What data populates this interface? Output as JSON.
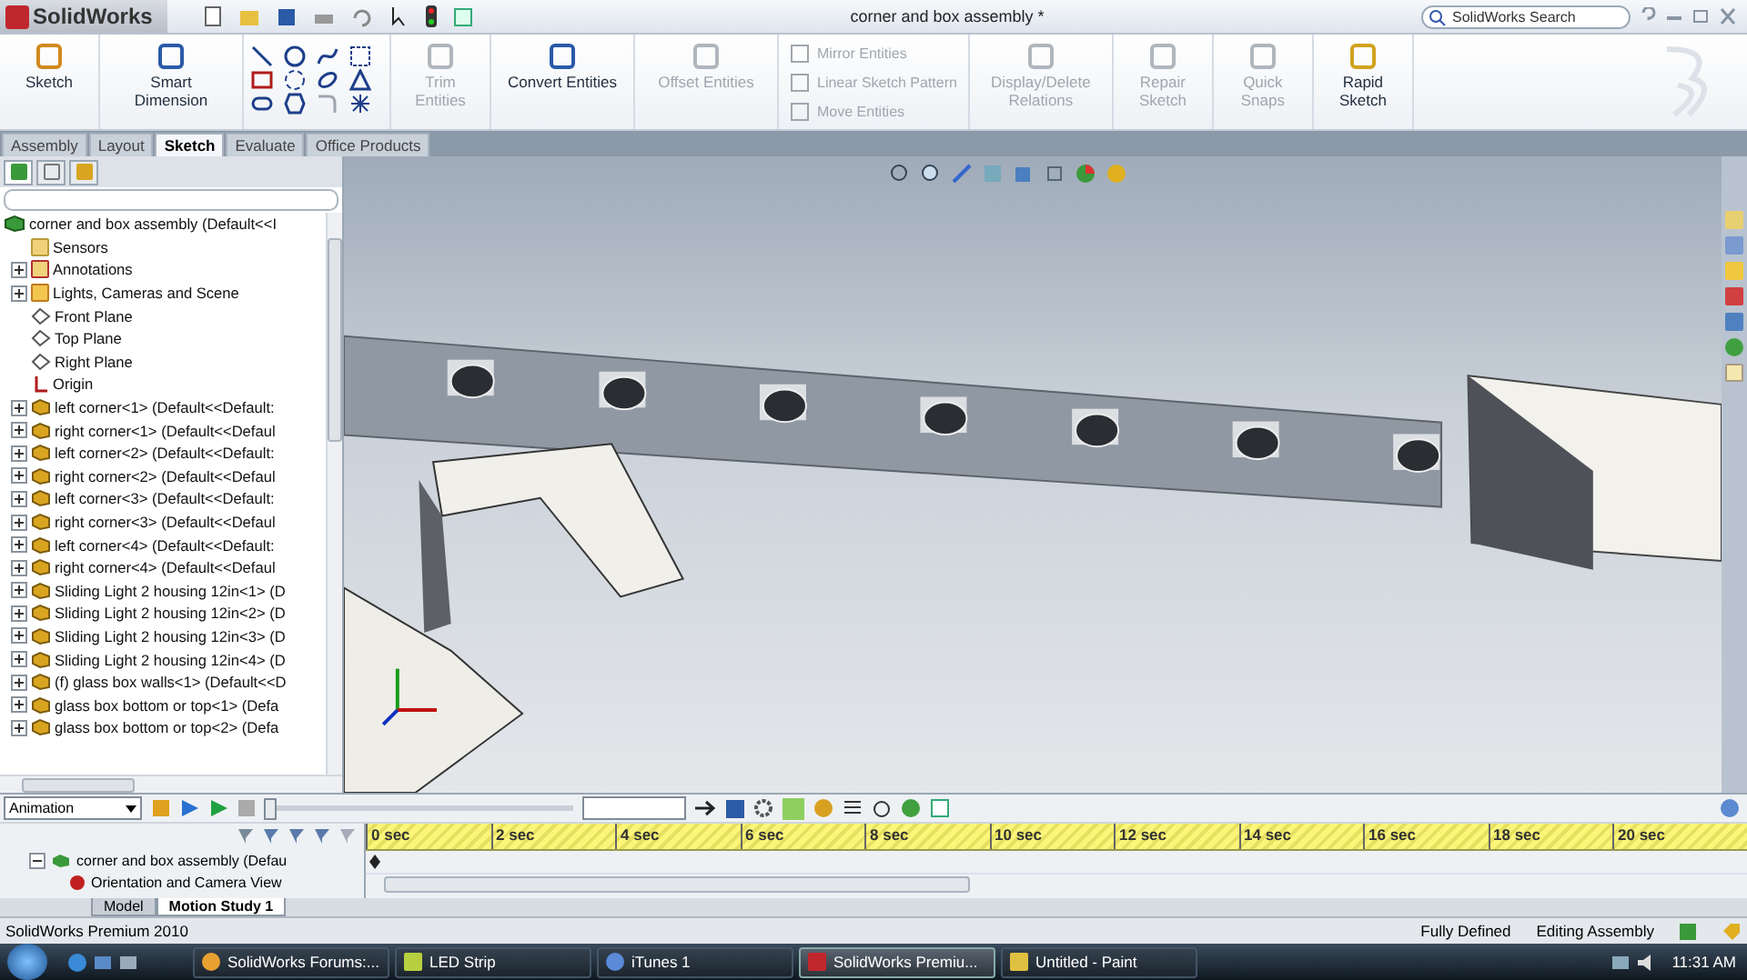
{
  "window": {
    "app_name": "SolidWorks",
    "title": "corner and box assembly *",
    "search": {
      "placeholder": "SolidWorks Search"
    }
  },
  "ribbon": {
    "commands": [
      {
        "label": "Sketch",
        "disabled": false,
        "kind": "large"
      },
      {
        "label": "Smart Dimension",
        "disabled": false,
        "kind": "large"
      },
      {
        "kind": "tools"
      },
      {
        "label": "Trim Entities",
        "disabled": true,
        "kind": "large"
      },
      {
        "label": "Convert Entities",
        "disabled": false,
        "kind": "large"
      },
      {
        "label": "Offset Entities",
        "disabled": true,
        "kind": "large"
      },
      {
        "kind": "list",
        "items": [
          {
            "label": "Mirror Entities",
            "disabled": true
          },
          {
            "label": "Linear Sketch Pattern",
            "disabled": true
          },
          {
            "label": "Move Entities",
            "disabled": true
          }
        ]
      },
      {
        "label": "Display/Delete Relations",
        "disabled": true,
        "kind": "large"
      },
      {
        "label": "Repair Sketch",
        "disabled": true,
        "kind": "large"
      },
      {
        "label": "Quick Snaps",
        "disabled": true,
        "kind": "large"
      },
      {
        "label": "Rapid Sketch",
        "disabled": false,
        "kind": "large"
      }
    ]
  },
  "command_tabs": [
    {
      "label": "Assembly",
      "selected": false
    },
    {
      "label": "Layout",
      "selected": false
    },
    {
      "label": "Sketch",
      "selected": true
    },
    {
      "label": "Evaluate",
      "selected": false
    },
    {
      "label": "Office Products",
      "selected": false
    }
  ],
  "feature_tree": {
    "root": "corner and box assembly  (Default<<I",
    "items": [
      {
        "label": "Sensors",
        "kind": "sensor",
        "expandable": false
      },
      {
        "label": "Annotations",
        "kind": "annotation",
        "expandable": true
      },
      {
        "label": "Lights, Cameras and Scene",
        "kind": "lights",
        "expandable": true
      },
      {
        "label": "Front Plane",
        "kind": "plane",
        "expandable": false
      },
      {
        "label": "Top Plane",
        "kind": "plane",
        "expandable": false
      },
      {
        "label": "Right Plane",
        "kind": "plane",
        "expandable": false
      },
      {
        "label": "Origin",
        "kind": "origin",
        "expandable": false
      },
      {
        "label": "left corner<1> (Default<<Default:",
        "kind": "part",
        "expandable": true
      },
      {
        "label": "right corner<1> (Default<<Defaul",
        "kind": "part",
        "expandable": true
      },
      {
        "label": "left corner<2> (Default<<Default:",
        "kind": "part",
        "expandable": true
      },
      {
        "label": "right corner<2> (Default<<Defaul",
        "kind": "part",
        "expandable": true
      },
      {
        "label": "left corner<3> (Default<<Default:",
        "kind": "part",
        "expandable": true
      },
      {
        "label": "right corner<3> (Default<<Defaul",
        "kind": "part",
        "expandable": true
      },
      {
        "label": "left corner<4> (Default<<Default:",
        "kind": "part",
        "expandable": true
      },
      {
        "label": "right corner<4> (Default<<Defaul",
        "kind": "part",
        "expandable": true
      },
      {
        "label": "Sliding Light 2 housing 12in<1> (D",
        "kind": "part",
        "expandable": true
      },
      {
        "label": "Sliding Light 2 housing 12in<2> (D",
        "kind": "part",
        "expandable": true
      },
      {
        "label": "Sliding Light 2 housing 12in<3> (D",
        "kind": "part",
        "expandable": true
      },
      {
        "label": "Sliding Light 2 housing 12in<4> (D",
        "kind": "part",
        "expandable": true
      },
      {
        "label": "(f) glass box walls<1> (Default<<D",
        "kind": "part",
        "expandable": true
      },
      {
        "label": "glass box bottom or top<1> (Defa",
        "kind": "part",
        "expandable": true
      },
      {
        "label": "glass box bottom or top<2> (Defa",
        "kind": "part",
        "expandable": true
      }
    ]
  },
  "motion": {
    "study_type": "Animation",
    "playback": {
      "level": 0
    },
    "time_labels": [
      "0 sec",
      "2 sec",
      "4 sec",
      "6 sec",
      "8 sec",
      "10 sec",
      "12 sec",
      "14 sec",
      "16 sec",
      "18 sec",
      "20 sec"
    ],
    "tree": [
      {
        "label": "corner and box assembly  (Defau",
        "kind": "assembly",
        "expanded": true
      },
      {
        "label": "Orientation and Camera View",
        "kind": "camera"
      }
    ]
  },
  "bottom_tabs": [
    {
      "label": "Model",
      "selected": false
    },
    {
      "label": "Motion Study 1",
      "selected": true
    }
  ],
  "status_bar": {
    "product": "SolidWorks Premium 2010",
    "items": [
      "Fully Defined",
      "Editing Assembly"
    ]
  },
  "taskbar": {
    "buttons": [
      {
        "label": "SolidWorks Forums:...",
        "selected": false
      },
      {
        "label": "LED Strip",
        "selected": false
      },
      {
        "label": "iTunes 1",
        "selected": false
      },
      {
        "label": "SolidWorks Premiu...",
        "selected": true
      },
      {
        "label": "Untitled - Paint",
        "selected": false
      }
    ],
    "clock": "11:31 AM"
  }
}
